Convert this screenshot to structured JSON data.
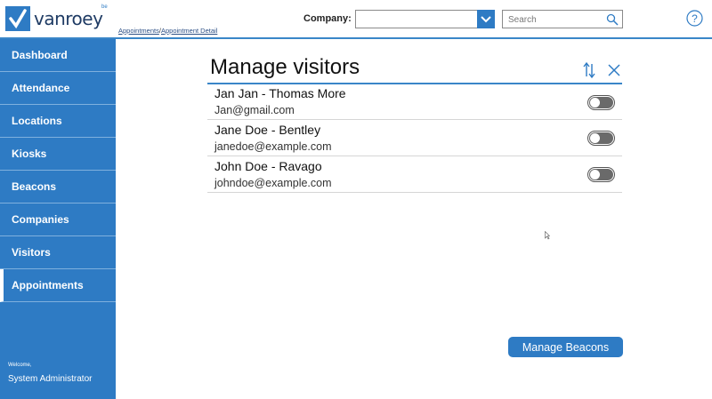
{
  "header": {
    "logo_text": "vanroey",
    "logo_sup": "be",
    "breadcrumb": {
      "items": [
        "Appointments",
        "Appointment Detail"
      ],
      "separator": "/"
    },
    "company_label": "Company:",
    "company_value": "",
    "search_placeholder": "Search"
  },
  "sidebar": {
    "items": [
      {
        "label": "Dashboard"
      },
      {
        "label": "Attendance"
      },
      {
        "label": "Locations"
      },
      {
        "label": "Kiosks"
      },
      {
        "label": "Beacons"
      },
      {
        "label": "Companies"
      },
      {
        "label": "Visitors"
      },
      {
        "label": "Appointments",
        "active": true
      }
    ],
    "welcome": "Welcome,",
    "user": "System Administrator"
  },
  "main": {
    "title": "Manage visitors",
    "visitors": [
      {
        "name": "Jan Jan - Thomas More",
        "email": "Jan@gmail.com",
        "enabled": false
      },
      {
        "name": "Jane Doe - Bentley",
        "email": "janedoe@example.com",
        "enabled": false
      },
      {
        "name": "John Doe - Ravago",
        "email": "johndoe@example.com",
        "enabled": false
      }
    ],
    "manage_beacons_label": "Manage Beacons"
  },
  "icons": {
    "sort": "sort-icon",
    "close": "close-icon",
    "search": "search-icon",
    "help": "help-icon",
    "dropdown": "chevron-down-icon"
  },
  "colors": {
    "accent": "#2e7bc4",
    "sidebar": "#2e7bc4",
    "divider": "#3a86c8"
  }
}
